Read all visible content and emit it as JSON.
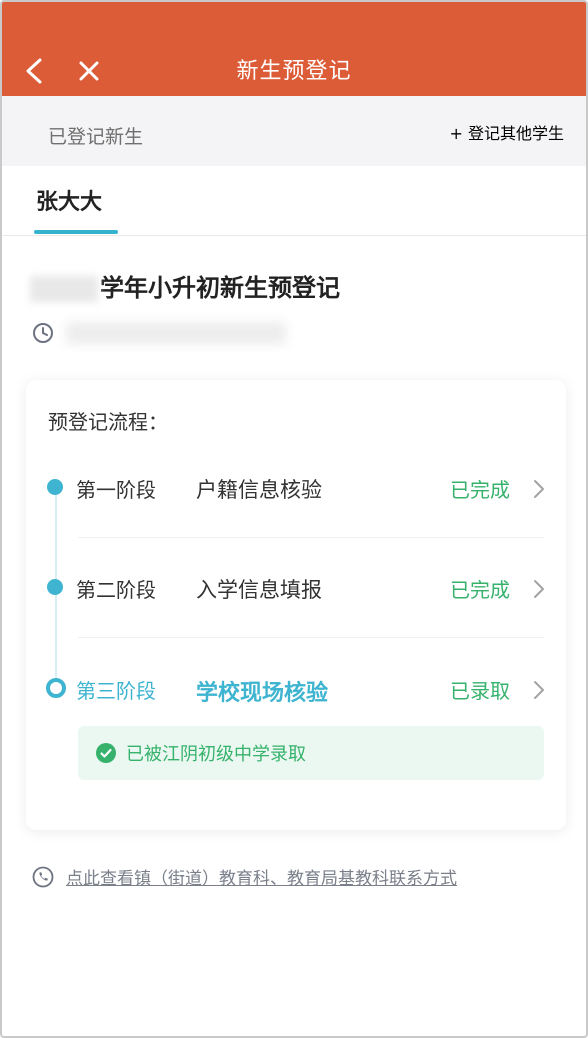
{
  "header": {
    "title": "新生预登记",
    "back_icon": "chevron-left-icon",
    "close_icon": "close-icon",
    "bg_color": "#dc5c37"
  },
  "registered_bar": {
    "label": "已登记新生",
    "add_label": "登记其他学生"
  },
  "tabs": [
    {
      "label": "张大大",
      "active": true
    }
  ],
  "page": {
    "title": "学年小升初新生预登记"
  },
  "card": {
    "heading": "预登记流程：",
    "steps": [
      {
        "stage": "第一阶段",
        "name": "户籍信息核验",
        "status": "已完成",
        "state": "done"
      },
      {
        "stage": "第二阶段",
        "name": "入学信息填报",
        "status": "已完成",
        "state": "done"
      },
      {
        "stage": "第三阶段",
        "name": "学校现场核验",
        "status": "已录取",
        "state": "current"
      }
    ],
    "admission_notice": "已被江阴初级中学录取"
  },
  "footer": {
    "contact_link": "点此查看镇（街道）教育科、教育局基教科联系方式"
  },
  "colors": {
    "accent_teal": "#3fb4d0",
    "success_green": "#36b26c"
  }
}
